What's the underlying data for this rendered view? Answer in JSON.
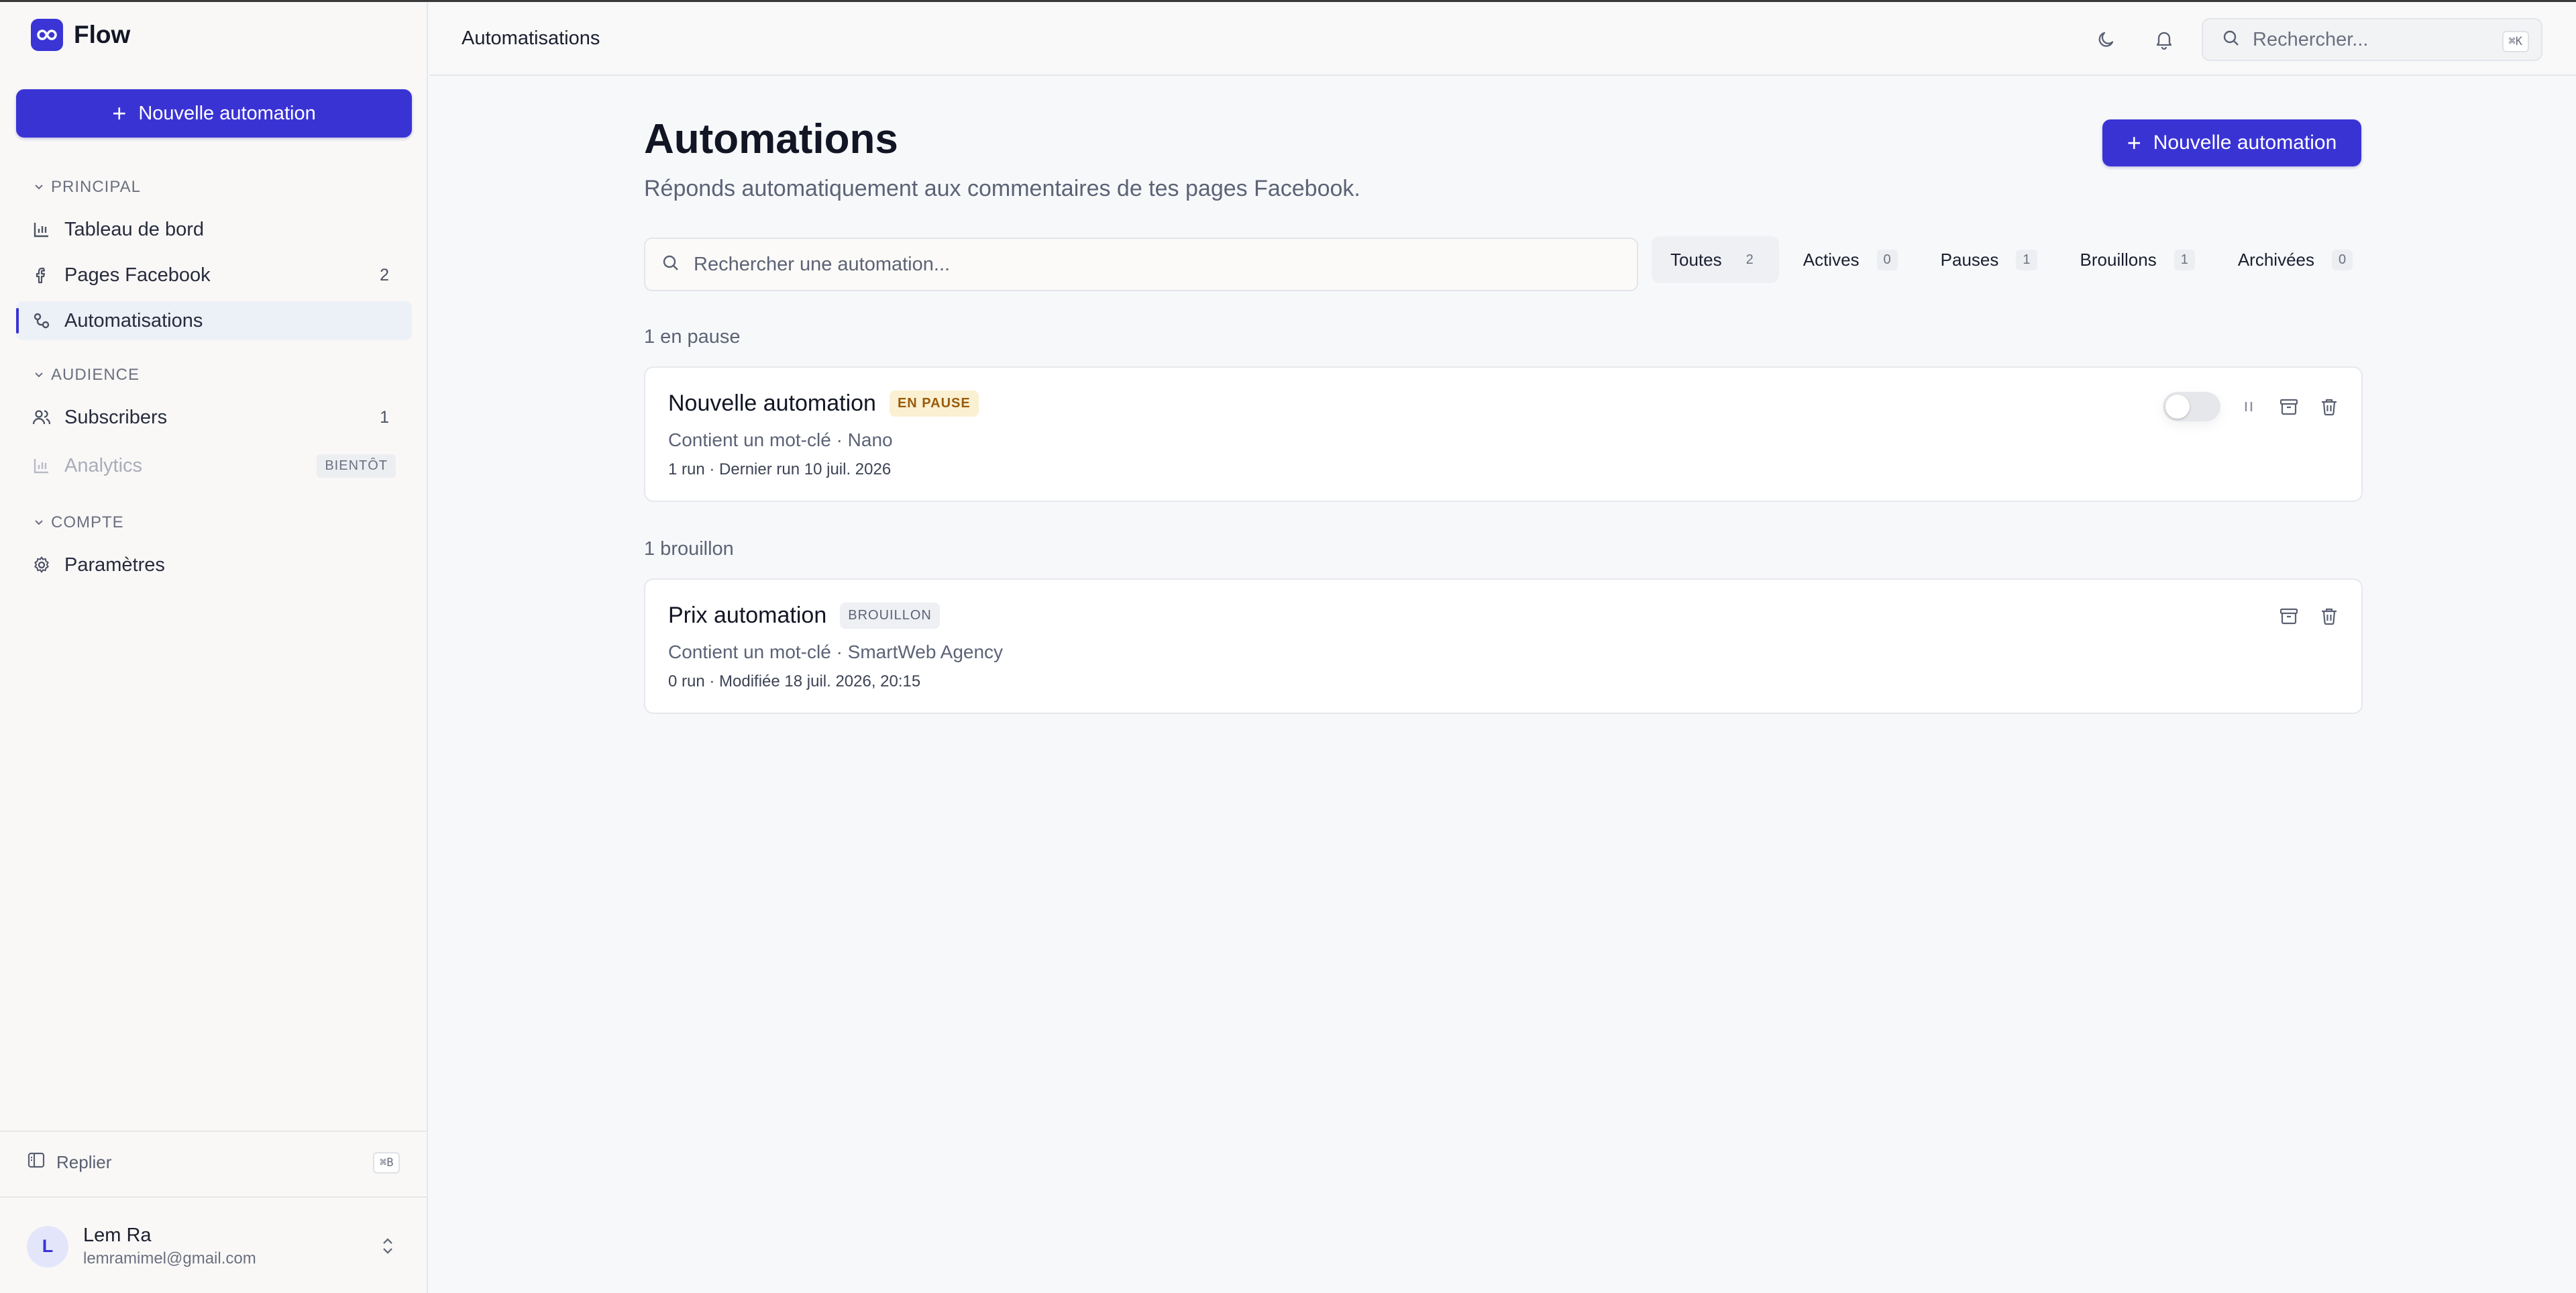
{
  "brand": {
    "name": "Flow"
  },
  "sidebar": {
    "new_button_label": "Nouvelle automation",
    "sections": [
      {
        "title": "PRINCIPAL"
      },
      {
        "title": "AUDIENCE"
      },
      {
        "title": "COMPTE"
      }
    ],
    "items": [
      {
        "label": "Tableau de bord",
        "icon": "bar-chart-icon"
      },
      {
        "label": "Pages Facebook",
        "icon": "facebook-icon",
        "count": "2"
      },
      {
        "label": "Automatisations",
        "icon": "workflow-icon",
        "active": true
      },
      {
        "label": "Subscribers",
        "icon": "users-icon",
        "count": "1"
      },
      {
        "label": "Analytics",
        "icon": "bar-chart-icon",
        "badge": "BIENTÔT",
        "disabled": true
      },
      {
        "label": "Paramètres",
        "icon": "gear-icon"
      }
    ],
    "collapse_label": "Replier",
    "collapse_shortcut": "⌘B",
    "user": {
      "initial": "L",
      "name": "Lem Ra",
      "email": "lemramimel@gmail.com"
    }
  },
  "header": {
    "breadcrumb": "Automatisations",
    "search_placeholder": "Rechercher...",
    "search_shortcut": "⌘K"
  },
  "main": {
    "title": "Automations",
    "subtitle": "Réponds automatiquement aux commentaires de tes pages Facebook.",
    "new_button_label": "Nouvelle automation",
    "search_placeholder": "Rechercher une automation...",
    "filters": [
      {
        "label": "Toutes",
        "count": "2",
        "active": true
      },
      {
        "label": "Actives",
        "count": "0"
      },
      {
        "label": "Pauses",
        "count": "1"
      },
      {
        "label": "Brouillons",
        "count": "1"
      },
      {
        "label": "Archivées",
        "count": "0"
      }
    ],
    "groups": [
      {
        "label": "1 en pause",
        "card": {
          "title": "Nouvelle automation",
          "status": "EN PAUSE",
          "line1": "Contient un mot-clé · Nano",
          "line2": "1 run · Dernier run 10 juil. 2026",
          "toggle_on": false
        }
      },
      {
        "label": "1 brouillon",
        "card": {
          "title": "Prix automation",
          "status": "BROUILLON",
          "line1": "Contient un mot-clé · SmartWeb Agency",
          "line2": "0 run · Modifiée 18 juil. 2026, 20:15"
        }
      }
    ]
  },
  "colors": {
    "accent": "#3a33d4",
    "paused_bg": "#fbf0d2",
    "paused_text": "#9a5b0c"
  }
}
